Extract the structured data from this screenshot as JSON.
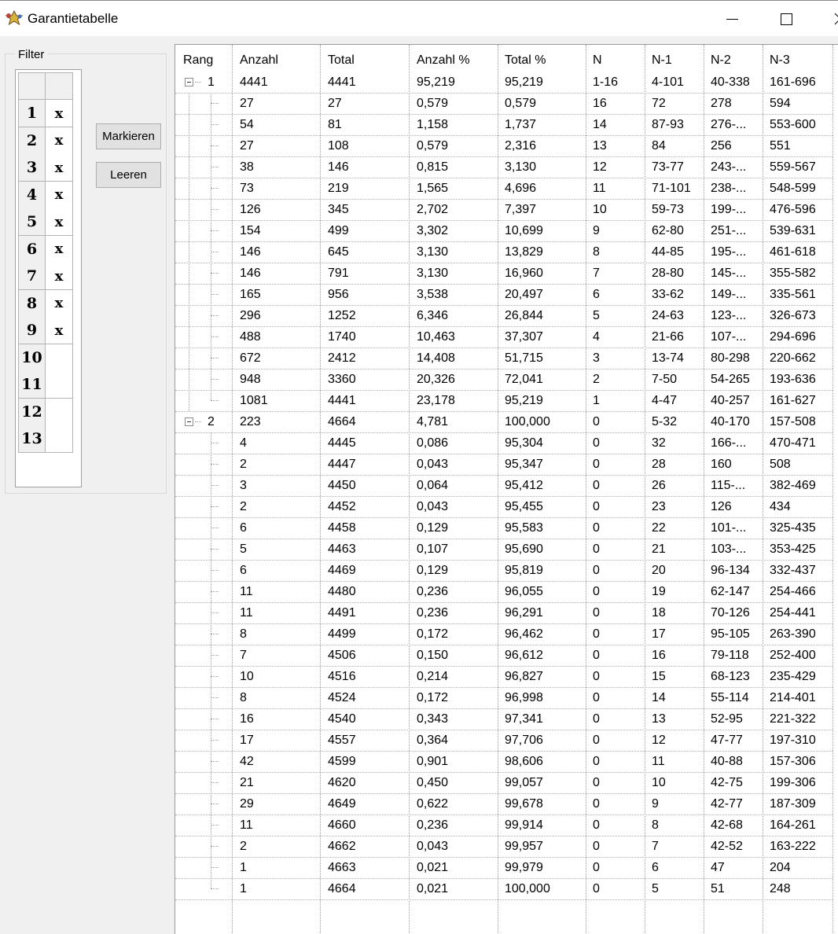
{
  "window": {
    "title": "Garantietabelle",
    "icon": "app-star-icon",
    "controls": [
      "minimize-icon",
      "maximize-icon",
      "close-icon"
    ]
  },
  "filter": {
    "legend": "Filter",
    "rows": [
      {
        "num": "1",
        "mark": "x"
      },
      {
        "num": "2",
        "mark": "x"
      },
      {
        "num": "3",
        "mark": "x"
      },
      {
        "num": "4",
        "mark": "x"
      },
      {
        "num": "5",
        "mark": "x"
      },
      {
        "num": "6",
        "mark": "x"
      },
      {
        "num": "7",
        "mark": "x"
      },
      {
        "num": "8",
        "mark": "x"
      },
      {
        "num": "9",
        "mark": "x"
      },
      {
        "num": "10",
        "mark": ""
      },
      {
        "num": "11",
        "mark": ""
      },
      {
        "num": "12",
        "mark": ""
      },
      {
        "num": "13",
        "mark": ""
      }
    ],
    "mark_button": "Markieren",
    "clear_button": "Leeren"
  },
  "table": {
    "columns": [
      "Rang",
      "Anzahl",
      "Total",
      "Anzahl %",
      "Total %",
      "N",
      "N-1",
      "N-2",
      "N-3"
    ],
    "rows": [
      {
        "level": 0,
        "rang": "1",
        "cells": [
          "4441",
          "4441",
          "95,219",
          "95,219",
          "1-16",
          "4-101",
          "40-338",
          "161-696"
        ]
      },
      {
        "level": 1,
        "rang": "",
        "cells": [
          "27",
          "27",
          "0,579",
          "0,579",
          "16",
          "72",
          "278",
          "594"
        ]
      },
      {
        "level": 1,
        "rang": "",
        "cells": [
          "54",
          "81",
          "1,158",
          "1,737",
          "14",
          "87-93",
          "276-...",
          "553-600"
        ]
      },
      {
        "level": 1,
        "rang": "",
        "cells": [
          "27",
          "108",
          "0,579",
          "2,316",
          "13",
          "84",
          "256",
          "551"
        ]
      },
      {
        "level": 1,
        "rang": "",
        "cells": [
          "38",
          "146",
          "0,815",
          "3,130",
          "12",
          "73-77",
          "243-...",
          "559-567"
        ]
      },
      {
        "level": 1,
        "rang": "",
        "cells": [
          "73",
          "219",
          "1,565",
          "4,696",
          "11",
          "71-101",
          "238-...",
          "548-599"
        ]
      },
      {
        "level": 1,
        "rang": "",
        "cells": [
          "126",
          "345",
          "2,702",
          "7,397",
          "10",
          "59-73",
          "199-...",
          "476-596"
        ]
      },
      {
        "level": 1,
        "rang": "",
        "cells": [
          "154",
          "499",
          "3,302",
          "10,699",
          "9",
          "62-80",
          "251-...",
          "539-631"
        ]
      },
      {
        "level": 1,
        "rang": "",
        "cells": [
          "146",
          "645",
          "3,130",
          "13,829",
          "8",
          "44-85",
          "195-...",
          "461-618"
        ]
      },
      {
        "level": 1,
        "rang": "",
        "cells": [
          "146",
          "791",
          "3,130",
          "16,960",
          "7",
          "28-80",
          "145-...",
          "355-582"
        ]
      },
      {
        "level": 1,
        "rang": "",
        "cells": [
          "165",
          "956",
          "3,538",
          "20,497",
          "6",
          "33-62",
          "149-...",
          "335-561"
        ]
      },
      {
        "level": 1,
        "rang": "",
        "cells": [
          "296",
          "1252",
          "6,346",
          "26,844",
          "5",
          "24-63",
          "123-...",
          "326-673"
        ]
      },
      {
        "level": 1,
        "rang": "",
        "cells": [
          "488",
          "1740",
          "10,463",
          "37,307",
          "4",
          "21-66",
          "107-...",
          "294-696"
        ]
      },
      {
        "level": 1,
        "rang": "",
        "cells": [
          "672",
          "2412",
          "14,408",
          "51,715",
          "3",
          "13-74",
          "80-298",
          "220-662"
        ]
      },
      {
        "level": 1,
        "rang": "",
        "cells": [
          "948",
          "3360",
          "20,326",
          "72,041",
          "2",
          "7-50",
          "54-265",
          "193-636"
        ]
      },
      {
        "level": 1,
        "rang": "",
        "cells": [
          "1081",
          "4441",
          "23,178",
          "95,219",
          "1",
          "4-47",
          "40-257",
          "161-627"
        ]
      },
      {
        "level": 0,
        "rang": "2",
        "cells": [
          "223",
          "4664",
          "4,781",
          "100,000",
          "0",
          "5-32",
          "40-170",
          "157-508"
        ]
      },
      {
        "level": 1,
        "rang": "",
        "cells": [
          "4",
          "4445",
          "0,086",
          "95,304",
          "0",
          "32",
          "166-...",
          "470-471"
        ]
      },
      {
        "level": 1,
        "rang": "",
        "cells": [
          "2",
          "4447",
          "0,043",
          "95,347",
          "0",
          "28",
          "160",
          "508"
        ]
      },
      {
        "level": 1,
        "rang": "",
        "cells": [
          "3",
          "4450",
          "0,064",
          "95,412",
          "0",
          "26",
          "115-...",
          "382-469"
        ]
      },
      {
        "level": 1,
        "rang": "",
        "cells": [
          "2",
          "4452",
          "0,043",
          "95,455",
          "0",
          "23",
          "126",
          "434"
        ]
      },
      {
        "level": 1,
        "rang": "",
        "cells": [
          "6",
          "4458",
          "0,129",
          "95,583",
          "0",
          "22",
          "101-...",
          "325-435"
        ]
      },
      {
        "level": 1,
        "rang": "",
        "cells": [
          "5",
          "4463",
          "0,107",
          "95,690",
          "0",
          "21",
          "103-...",
          "353-425"
        ]
      },
      {
        "level": 1,
        "rang": "",
        "cells": [
          "6",
          "4469",
          "0,129",
          "95,819",
          "0",
          "20",
          "96-134",
          "332-437"
        ]
      },
      {
        "level": 1,
        "rang": "",
        "cells": [
          "11",
          "4480",
          "0,236",
          "96,055",
          "0",
          "19",
          "62-147",
          "254-466"
        ]
      },
      {
        "level": 1,
        "rang": "",
        "cells": [
          "11",
          "4491",
          "0,236",
          "96,291",
          "0",
          "18",
          "70-126",
          "254-441"
        ]
      },
      {
        "level": 1,
        "rang": "",
        "cells": [
          "8",
          "4499",
          "0,172",
          "96,462",
          "0",
          "17",
          "95-105",
          "263-390"
        ]
      },
      {
        "level": 1,
        "rang": "",
        "cells": [
          "7",
          "4506",
          "0,150",
          "96,612",
          "0",
          "16",
          "79-118",
          "252-400"
        ]
      },
      {
        "level": 1,
        "rang": "",
        "cells": [
          "10",
          "4516",
          "0,214",
          "96,827",
          "0",
          "15",
          "68-123",
          "235-429"
        ]
      },
      {
        "level": 1,
        "rang": "",
        "cells": [
          "8",
          "4524",
          "0,172",
          "96,998",
          "0",
          "14",
          "55-114",
          "214-401"
        ]
      },
      {
        "level": 1,
        "rang": "",
        "cells": [
          "16",
          "4540",
          "0,343",
          "97,341",
          "0",
          "13",
          "52-95",
          "221-322"
        ]
      },
      {
        "level": 1,
        "rang": "",
        "cells": [
          "17",
          "4557",
          "0,364",
          "97,706",
          "0",
          "12",
          "47-77",
          "197-310"
        ]
      },
      {
        "level": 1,
        "rang": "",
        "cells": [
          "42",
          "4599",
          "0,901",
          "98,606",
          "0",
          "11",
          "40-88",
          "157-306"
        ]
      },
      {
        "level": 1,
        "rang": "",
        "cells": [
          "21",
          "4620",
          "0,450",
          "99,057",
          "0",
          "10",
          "42-75",
          "199-306"
        ]
      },
      {
        "level": 1,
        "rang": "",
        "cells": [
          "29",
          "4649",
          "0,622",
          "99,678",
          "0",
          "9",
          "42-77",
          "187-309"
        ]
      },
      {
        "level": 1,
        "rang": "",
        "cells": [
          "11",
          "4660",
          "0,236",
          "99,914",
          "0",
          "8",
          "42-68",
          "164-261"
        ]
      },
      {
        "level": 1,
        "rang": "",
        "cells": [
          "2",
          "4662",
          "0,043",
          "99,957",
          "0",
          "7",
          "42-52",
          "163-222"
        ]
      },
      {
        "level": 1,
        "rang": "",
        "cells": [
          "1",
          "4663",
          "0,021",
          "99,979",
          "0",
          "6",
          "47",
          "204"
        ]
      },
      {
        "level": 1,
        "rang": "",
        "cells": [
          "1",
          "4664",
          "0,021",
          "100,000",
          "0",
          "5",
          "51",
          "248"
        ]
      }
    ]
  }
}
